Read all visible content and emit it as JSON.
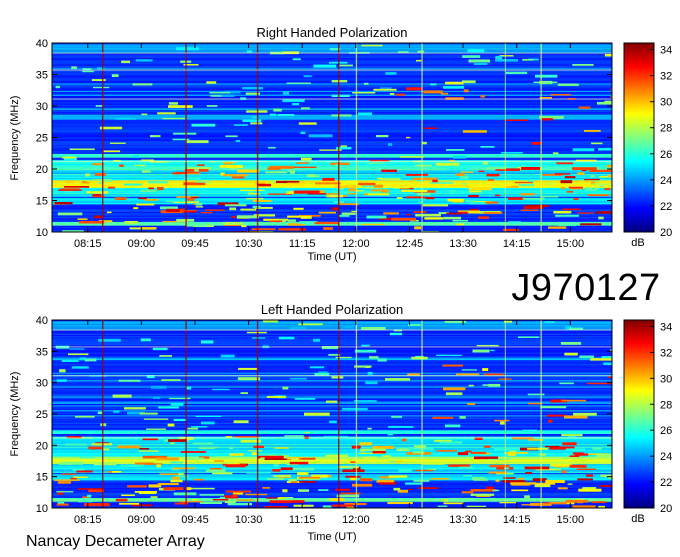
{
  "figure": {
    "observation_id": "J970127",
    "instrument": "Nancay Decameter Array"
  },
  "colorbar": {
    "ticks": [
      "34",
      "32",
      "30",
      "28",
      "26",
      "24",
      "22",
      "20"
    ],
    "unit": "dB",
    "colors": [
      "#00007f",
      "#0000ff",
      "#0080ff",
      "#00ffff",
      "#80ff80",
      "#ffff00",
      "#ff8000",
      "#ff0000",
      "#7f0000"
    ]
  },
  "chart_data": [
    {
      "type": "heatmap",
      "title": "Right Handed Polarization",
      "xlabel": "Time (UT)",
      "ylabel": "Frequency (MHz)",
      "x_ticks": [
        "08:15",
        "09:00",
        "09:45",
        "10:30",
        "11:15",
        "12:00",
        "12:45",
        "13:30",
        "14:15",
        "15:00"
      ],
      "y_ticks": [
        "40",
        "35",
        "30",
        "25",
        "20",
        "15",
        "10"
      ],
      "x_range": [
        "07:45",
        "15:35"
      ],
      "ylim": [
        10,
        40
      ],
      "color_scale_db": [
        20,
        34.5
      ],
      "colorbar_label": "dB"
    },
    {
      "type": "heatmap",
      "title": "Left Handed Polarization",
      "xlabel": "Time (UT)",
      "ylabel": "Frequency (MHz)",
      "x_ticks": [
        "08:15",
        "09:00",
        "09:45",
        "10:30",
        "11:15",
        "12:00",
        "12:45",
        "13:30",
        "14:15",
        "15:00"
      ],
      "y_ticks": [
        "40",
        "35",
        "30",
        "25",
        "20",
        "15",
        "10"
      ],
      "x_range": [
        "07:45",
        "15:35"
      ],
      "ylim": [
        10,
        40
      ],
      "color_scale_db": [
        20,
        34.5
      ],
      "colorbar_label": "dB"
    }
  ]
}
